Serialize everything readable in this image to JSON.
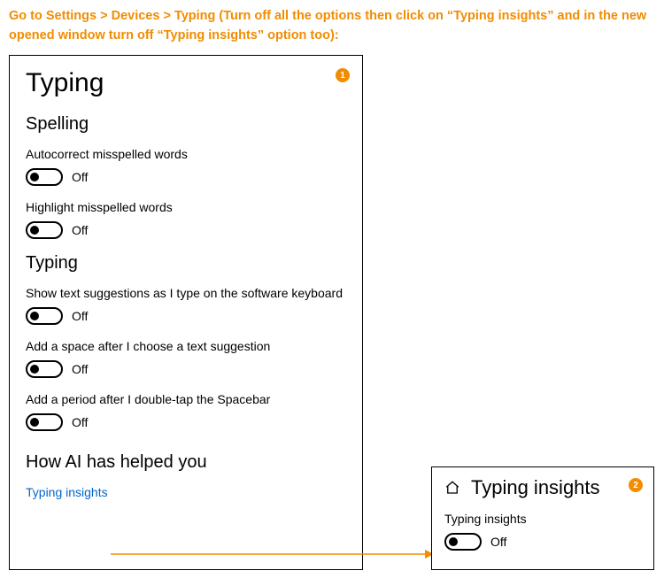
{
  "instruction": "Go to Settings > Devices > Typing (Turn off all the options then click on “Typing insights” and in the new opened window turn off “Typing insights” option too):",
  "badges": {
    "main": "1",
    "sub": "2"
  },
  "main": {
    "title": "Typing",
    "sections": {
      "spelling": {
        "heading": "Spelling",
        "settings": [
          {
            "label": "Autocorrect misspelled words",
            "state": "Off"
          },
          {
            "label": "Highlight misspelled words",
            "state": "Off"
          }
        ]
      },
      "typing": {
        "heading": "Typing",
        "settings": [
          {
            "label": "Show text suggestions as I type on the software keyboard",
            "state": "Off"
          },
          {
            "label": "Add a space after I choose a text suggestion",
            "state": "Off"
          },
          {
            "label": "Add a period after I double-tap the Spacebar",
            "state": "Off"
          }
        ]
      },
      "ai": {
        "heading": "How AI has helped you",
        "link": "Typing insights"
      }
    }
  },
  "sub": {
    "title": "Typing insights",
    "setting": {
      "label": "Typing insights",
      "state": "Off"
    }
  }
}
